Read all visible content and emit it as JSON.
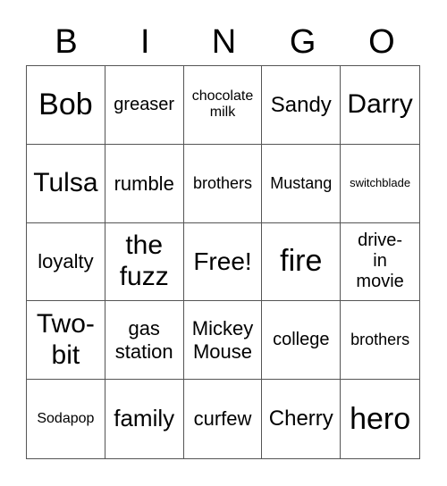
{
  "header": [
    "B",
    "I",
    "N",
    "G",
    "O"
  ],
  "cells": [
    "Bob",
    "greaser",
    "chocolate milk",
    "Sandy",
    "Darry",
    "Tulsa",
    "rumble",
    "brothers",
    "Mustang",
    "switchblade",
    "loyalty",
    "the fuzz",
    "Free!",
    "fire",
    "drive-in movie",
    "Two-bit",
    "gas station",
    "Mickey Mouse",
    "college",
    "brothers",
    "Sodapop",
    "family",
    "curfew",
    "Cherry",
    "hero"
  ]
}
